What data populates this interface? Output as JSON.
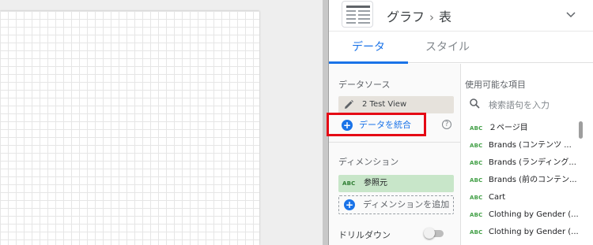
{
  "header": {
    "chart_type": "グラフ",
    "separator": "›",
    "chart_subtype": "表"
  },
  "tabs": [
    {
      "label": "データ",
      "active": true
    },
    {
      "label": "スタイル",
      "active": false
    }
  ],
  "data_source": {
    "section_title": "データソース",
    "source_name": "2 Test View",
    "blend_label": "データを統合",
    "help_glyph": "?"
  },
  "dimension": {
    "section_title": "ディメンション",
    "type_badge": "ABC",
    "field": "参照元",
    "add_label": "ディメンションを追加",
    "drilldown_label": "ドリルダウン",
    "drilldown_enabled": false
  },
  "available_fields": {
    "section_title": "使用可能な項目",
    "search_placeholder": "検索語句を入力",
    "type_badge": "ABC",
    "items": [
      "２ページ目",
      "Brands (コンテンツ ...",
      "Brands (ランディング...",
      "Brands (前のコンテン...",
      "Cart",
      "Clothing by Gender (...",
      "Clothing by Gender (..."
    ]
  },
  "colors": {
    "accent": "#1a73e8",
    "highlight": "#e50914",
    "dimension_chip": "#c8e6c9",
    "dimension_badge": "#2e7d32",
    "source_chip": "#e6e2dc"
  }
}
